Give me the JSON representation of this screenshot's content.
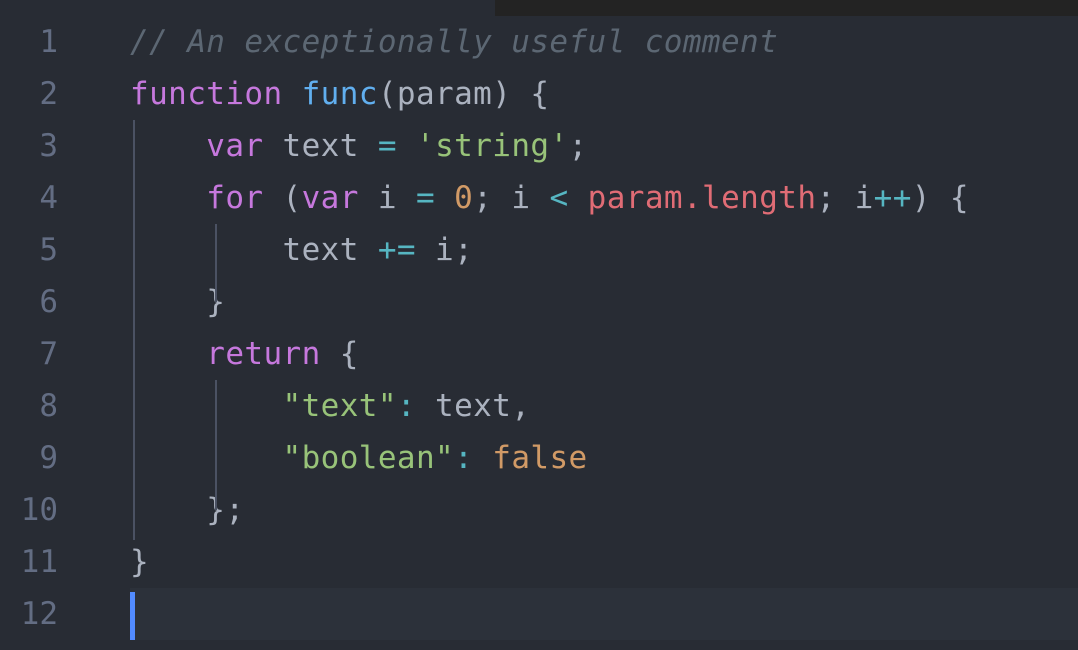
{
  "editor": {
    "name": "code-editor",
    "language": "javascript",
    "theme": "One Dark",
    "background_color": "#282c34",
    "gutter_color": "#282c34",
    "active_line_color": "#2c313a",
    "caret_color": "#528bff",
    "indent_guide_color": "#4b5263",
    "void_color": "#232323",
    "total_lines": 12,
    "cursor_line": 12,
    "cursor_column": 1,
    "palette": {
      "comment": "#5c6773",
      "keyword": "#c678dd",
      "function": "#61afef",
      "variable": "#abb2bf",
      "operator": "#56b6c2",
      "string": "#98c379",
      "number": "#d19a66",
      "constant": "#d19a66",
      "property": "#e06c75",
      "punctuation": "#abb2bf",
      "line_number": "#636d83"
    }
  },
  "lines": [
    {
      "number": "1",
      "active": false,
      "text": "// An exceptionally useful comment",
      "tokens": [
        {
          "text": "// An exceptionally useful comment",
          "type": "comment"
        }
      ]
    },
    {
      "number": "2",
      "active": false,
      "text": "function func(param) {",
      "tokens": [
        {
          "text": "function",
          "type": "keyword"
        },
        {
          "text": " ",
          "type": "punct"
        },
        {
          "text": "func",
          "type": "function"
        },
        {
          "text": "(param) {",
          "type": "punct"
        }
      ]
    },
    {
      "number": "3",
      "active": false,
      "text": "    var text = 'string';",
      "tokens": [
        {
          "text": "    ",
          "type": "punct"
        },
        {
          "text": "var",
          "type": "keyword"
        },
        {
          "text": " text ",
          "type": "variable"
        },
        {
          "text": "=",
          "type": "operator"
        },
        {
          "text": " ",
          "type": "punct"
        },
        {
          "text": "'string'",
          "type": "string"
        },
        {
          "text": ";",
          "type": "punct"
        }
      ]
    },
    {
      "number": "4",
      "active": false,
      "text": "    for (var i = 0; i < param.length; i++) {",
      "tokens": [
        {
          "text": "    ",
          "type": "punct"
        },
        {
          "text": "for",
          "type": "keyword"
        },
        {
          "text": " (",
          "type": "punct"
        },
        {
          "text": "var",
          "type": "keyword"
        },
        {
          "text": " i ",
          "type": "variable"
        },
        {
          "text": "=",
          "type": "operator"
        },
        {
          "text": " ",
          "type": "punct"
        },
        {
          "text": "0",
          "type": "number"
        },
        {
          "text": "; i ",
          "type": "punct"
        },
        {
          "text": "<",
          "type": "operator"
        },
        {
          "text": " ",
          "type": "punct"
        },
        {
          "text": "param.length",
          "type": "property"
        },
        {
          "text": "; i",
          "type": "punct"
        },
        {
          "text": "++",
          "type": "operator"
        },
        {
          "text": ") {",
          "type": "punct"
        }
      ]
    },
    {
      "number": "5",
      "active": false,
      "text": "        text += i;",
      "tokens": [
        {
          "text": "        text ",
          "type": "variable"
        },
        {
          "text": "+=",
          "type": "operator"
        },
        {
          "text": " i;",
          "type": "punct"
        }
      ]
    },
    {
      "number": "6",
      "active": false,
      "text": "    }",
      "tokens": [
        {
          "text": "    }",
          "type": "punct"
        }
      ]
    },
    {
      "number": "7",
      "active": false,
      "text": "    return {",
      "tokens": [
        {
          "text": "    ",
          "type": "punct"
        },
        {
          "text": "return",
          "type": "keyword"
        },
        {
          "text": " {",
          "type": "punct"
        }
      ]
    },
    {
      "number": "8",
      "active": false,
      "text": "        \"text\": text,",
      "tokens": [
        {
          "text": "        ",
          "type": "punct"
        },
        {
          "text": "\"text\"",
          "type": "key"
        },
        {
          "text": ":",
          "type": "operator"
        },
        {
          "text": " text,",
          "type": "variable"
        }
      ]
    },
    {
      "number": "9",
      "active": false,
      "text": "        \"boolean\": false",
      "tokens": [
        {
          "text": "        ",
          "type": "punct"
        },
        {
          "text": "\"boolean\"",
          "type": "key"
        },
        {
          "text": ":",
          "type": "operator"
        },
        {
          "text": " ",
          "type": "punct"
        },
        {
          "text": "false",
          "type": "constant"
        }
      ]
    },
    {
      "number": "10",
      "active": false,
      "text": "    };",
      "tokens": [
        {
          "text": "    };",
          "type": "punct"
        }
      ]
    },
    {
      "number": "11",
      "active": false,
      "text": "}",
      "tokens": [
        {
          "text": "}",
          "type": "punct"
        }
      ]
    },
    {
      "number": "12",
      "active": true,
      "text": "",
      "tokens": []
    }
  ]
}
